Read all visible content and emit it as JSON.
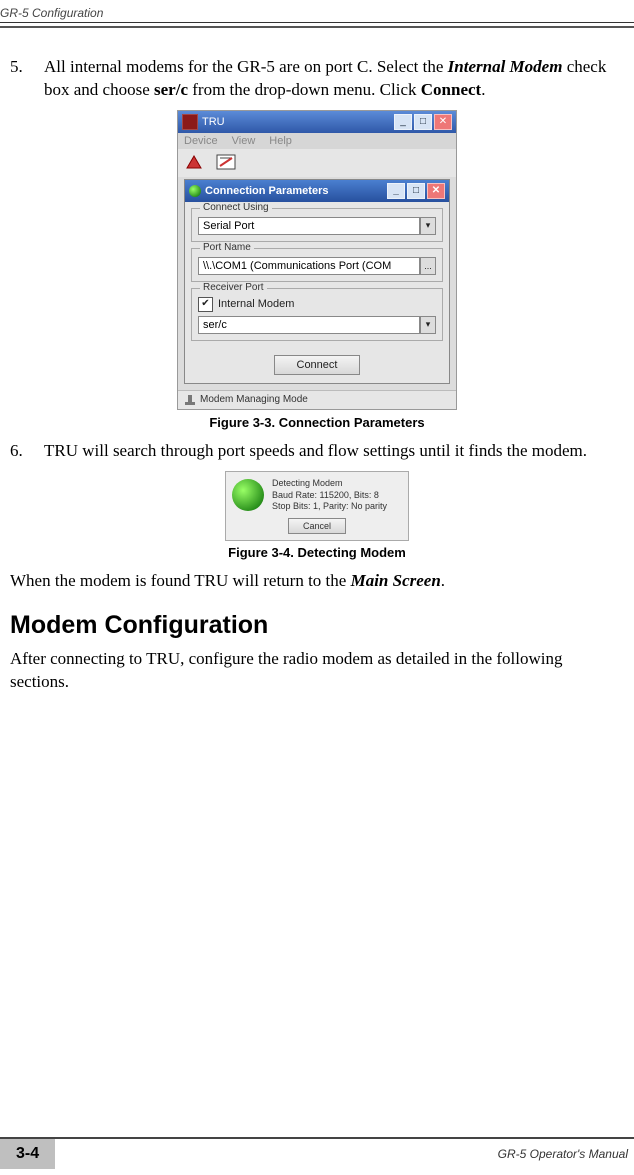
{
  "header": {
    "label": "GR-5 Configuration"
  },
  "step5": {
    "num": "5.",
    "t1": "All internal modems for the GR-5 are on port C. Select the ",
    "t2": "Internal Modem",
    "t3": " check box and choose ",
    "t4": "ser/c",
    "t5": " from the drop-down menu. Click ",
    "t6": "Connect",
    "t7": "."
  },
  "fig33": {
    "caption": "Figure 3-3. Connection Parameters",
    "tru": {
      "title": "TRU",
      "menu": {
        "device": "Device",
        "view": "View",
        "help": "Help"
      },
      "dialogTitle": "Connection Parameters",
      "groups": {
        "connectUsing": {
          "legend": "Connect Using",
          "value": "Serial Port"
        },
        "portName": {
          "legend": "Port Name",
          "value": "\\\\.\\COM1 (Communications Port (COM",
          "browse": "..."
        },
        "receiverPort": {
          "legend": "Receiver Port",
          "checkLabel": "Internal Modem",
          "value": "ser/c"
        }
      },
      "connectBtn": "Connect",
      "status": "Modem Managing Mode",
      "winMin": "_",
      "winMax": "□",
      "winClose": "✕",
      "ddArrow": "▾",
      "check": "✔"
    }
  },
  "step6": {
    "num": "6.",
    "text": "TRU will search through port speeds and flow settings until it finds the modem."
  },
  "fig34": {
    "caption": "Figure 3-4. Detecting Modem",
    "dialog": {
      "line1": "Detecting Modem",
      "line2": "Baud Rate: 115200, Bits: 8",
      "line3": "Stop Bits: 1, Parity: No parity",
      "cancel": "Cancel"
    }
  },
  "afterFig34": {
    "t1": "When the modem is found TRU will return to the ",
    "t2": "Main Screen",
    "t3": "."
  },
  "sectionHeading": "Modem Configuration",
  "sectionPara": "After connecting to TRU, configure the radio modem as detailed in the following sections.",
  "footer": {
    "page": "3-4",
    "manual": "GR-5 Operator's Manual"
  }
}
